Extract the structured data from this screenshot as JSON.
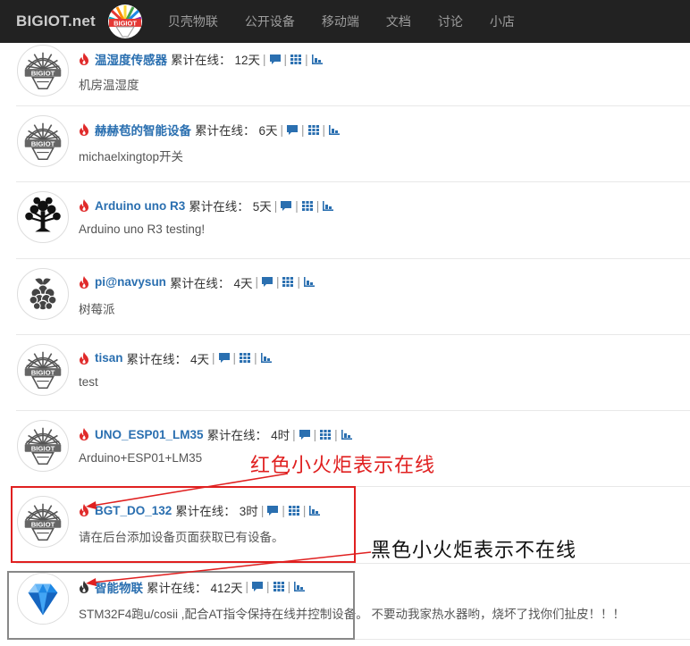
{
  "navbar": {
    "brand": "BIGIOT.net",
    "logo_text": "BIGIOT",
    "links": [
      "贝壳物联",
      "公开设备",
      "移动端",
      "文档",
      "讨论",
      "小店"
    ]
  },
  "colors": {
    "link": "#2a6fb0",
    "flame_online": "#e02a2a",
    "flame_offline": "#333333",
    "icon_blue": "#2a6fb0",
    "annotation_red": "#e02020"
  },
  "devices": [
    {
      "name": "温湿度传感器",
      "online_label": "累计在线：",
      "online_value": "12天",
      "desc": "机房温湿度",
      "avatar": "shell-icon",
      "status": "online"
    },
    {
      "name": "赫赫苞的智能设备",
      "online_label": "累计在线：",
      "online_value": "6天",
      "desc": "michaelxingtop开关",
      "avatar": "shell-icon",
      "status": "online"
    },
    {
      "name": "Arduino uno R3",
      "online_label": "累计在线：",
      "online_value": "5天",
      "desc": "Arduino uno R3 testing!",
      "avatar": "tree-icon",
      "status": "online"
    },
    {
      "name": "pi@navysun",
      "online_label": "累计在线：",
      "online_value": "4天",
      "desc": "树莓派",
      "avatar": "raspberry-icon",
      "status": "online"
    },
    {
      "name": "tisan",
      "online_label": "累计在线：",
      "online_value": "4天",
      "desc": "test",
      "avatar": "shell-icon",
      "status": "online"
    },
    {
      "name": "UNO_ESP01_LM35",
      "online_label": "累计在线：",
      "online_value": "4时",
      "desc": "Arduino+ESP01+LM35",
      "avatar": "shell-icon",
      "status": "online"
    },
    {
      "name": "BGT_DO_132",
      "online_label": "累计在线：",
      "online_value": "3时",
      "desc": "请在后台添加设备页面获取已有设备。",
      "avatar": "shell-icon",
      "status": "online"
    },
    {
      "name": "智能物联",
      "online_label": "累计在线：",
      "online_value": "412天",
      "desc": "STM32F4跑u/cosii ,配合AT指令保持在线并控制设备。 不要动我家热水器哟，烧坏了找你们扯皮！！！",
      "avatar": "diamond-icon",
      "status": "offline"
    }
  ],
  "annotations": {
    "red_text": "红色小火炬表示在线",
    "black_text": "黑色小火炬表示不在线"
  }
}
